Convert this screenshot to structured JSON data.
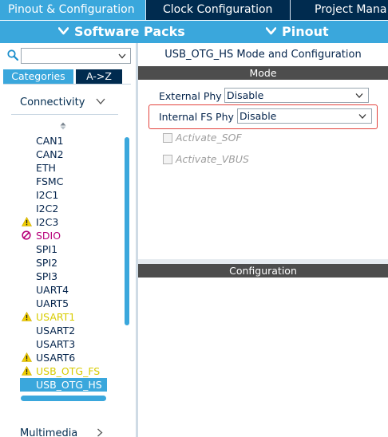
{
  "tabs": [
    {
      "label": "Pinout & Configuration",
      "active": true
    },
    {
      "label": "Clock Configuration",
      "active": false
    },
    {
      "label": "Project Mana",
      "active": false
    }
  ],
  "secondary_bar": {
    "software_packs": "Software Packs",
    "pinout": "Pinout"
  },
  "sidebar": {
    "search": {
      "value": "",
      "placeholder": ""
    },
    "view_tabs": {
      "categories": "Categories",
      "az": "A->Z"
    },
    "category": "Connectivity",
    "peripherals": [
      {
        "label": "CAN1",
        "status": "normal"
      },
      {
        "label": "CAN2",
        "status": "normal"
      },
      {
        "label": "ETH",
        "status": "normal"
      },
      {
        "label": "FSMC",
        "status": "normal"
      },
      {
        "label": "I2C1",
        "status": "normal"
      },
      {
        "label": "I2C2",
        "status": "normal"
      },
      {
        "label": "I2C3",
        "status": "warning"
      },
      {
        "label": "SDIO",
        "status": "disabled"
      },
      {
        "label": "SPI1",
        "status": "normal"
      },
      {
        "label": "SPI2",
        "status": "normal"
      },
      {
        "label": "SPI3",
        "status": "normal"
      },
      {
        "label": "UART4",
        "status": "normal"
      },
      {
        "label": "UART5",
        "status": "normal"
      },
      {
        "label": "USART1",
        "status": "configured"
      },
      {
        "label": "USART2",
        "status": "normal"
      },
      {
        "label": "USART3",
        "status": "normal"
      },
      {
        "label": "USART6",
        "status": "warning"
      },
      {
        "label": "USB_OTG_FS",
        "status": "warning-configured"
      },
      {
        "label": "USB_OTG_HS",
        "status": "selected"
      }
    ],
    "next_category": "Multimedia"
  },
  "mode_panel": {
    "title": "USB_OTG_HS Mode and Configuration",
    "section_header": "Mode",
    "external_phy": {
      "label": "External Phy",
      "value": "Disable"
    },
    "internal_fs_phy": {
      "label": "Internal FS Phy",
      "value": "Disable"
    },
    "activate_sof": "Activate_SOF",
    "activate_vbus": "Activate_VBUS"
  },
  "configuration_panel": {
    "section_header": "Configuration"
  },
  "colors": {
    "navy": "#002b4f",
    "accent_blue": "#3aa7dc",
    "warning_yellow": "#d8cc00",
    "error_magenta": "#b7007a",
    "highlight_red": "#e3433d",
    "header_gray": "#4d4d4d"
  },
  "icons": {
    "search": "search-icon",
    "warning": "warning-icon",
    "disabled": "ban-icon",
    "chevron_down": "chevron-down-icon",
    "chevron_right": "chevron-right-icon",
    "sort": "sort-arrow-icon"
  }
}
